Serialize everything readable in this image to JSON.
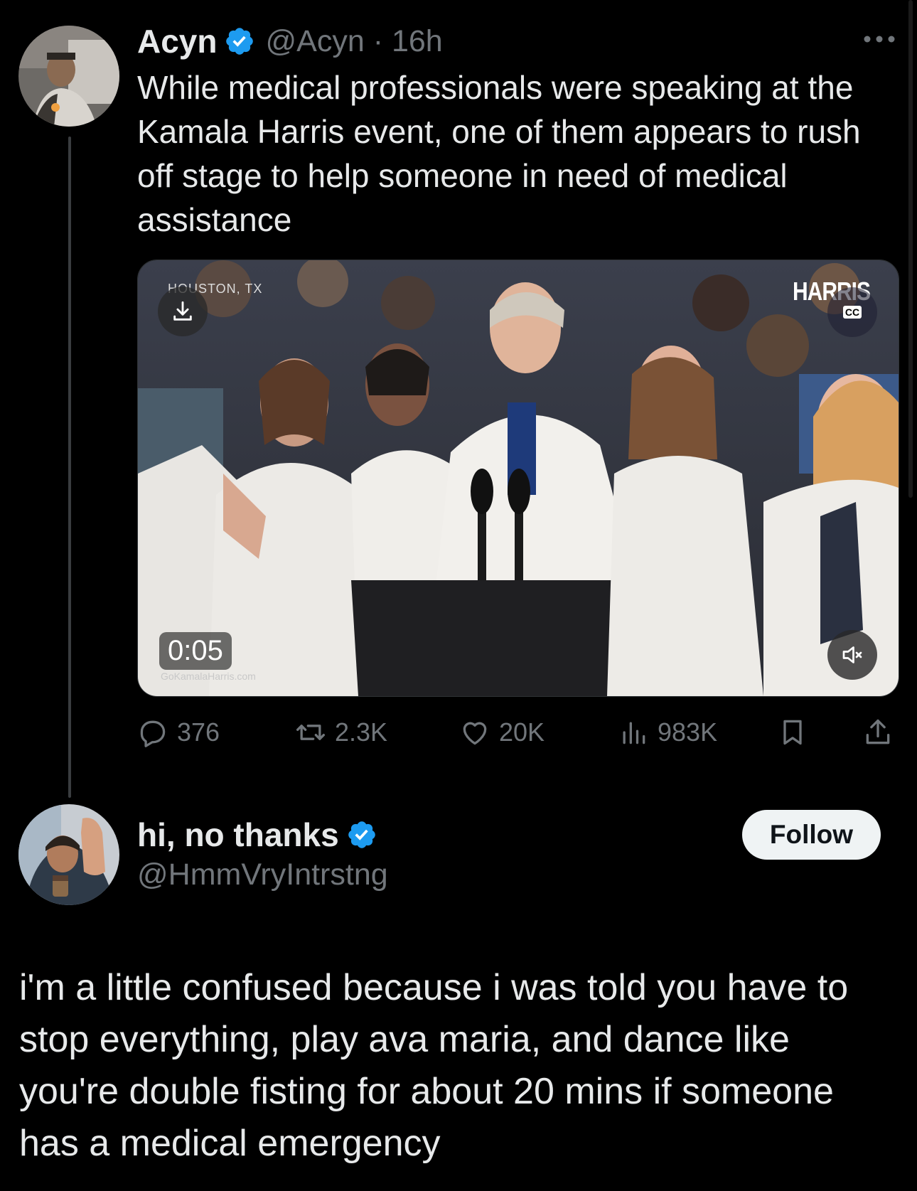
{
  "tweet": {
    "display_name": "Acyn",
    "handle": "@Acyn",
    "separator": "·",
    "time": "16h",
    "text": "While medical professionals were speaking at the Kamala Harris event, one of them appears to rush off stage to help someone in need of medical assistance",
    "media": {
      "location_label": "HOUSTON, TX",
      "brand_label": "HARRIS",
      "cc_label": "CC",
      "duration": "0:05",
      "watermark": "GoKamalaHarris.com"
    },
    "stats": {
      "replies": "376",
      "retweets": "2.3K",
      "likes": "20K",
      "views": "983K"
    }
  },
  "reply": {
    "display_name": "hi, no thanks",
    "handle": "@HmmVryIntrstng",
    "follow_label": "Follow",
    "text": "i'm a little confused because i was told you have to stop everything, play ava maria, and dance like you're double fisting for about 20 mins if someone has a medical emergency"
  },
  "colors": {
    "background": "#000000",
    "text_primary": "#e7e9ea",
    "text_secondary": "#71767b",
    "verified_blue": "#1d9bf0",
    "follow_button_bg": "#eff3f4"
  },
  "icons": [
    "verified-badge-icon",
    "more-options-icon",
    "download-icon",
    "closed-captions-icon",
    "muted-speaker-icon",
    "reply-icon",
    "retweet-icon",
    "like-icon",
    "views-icon",
    "bookmark-icon",
    "share-icon"
  ]
}
